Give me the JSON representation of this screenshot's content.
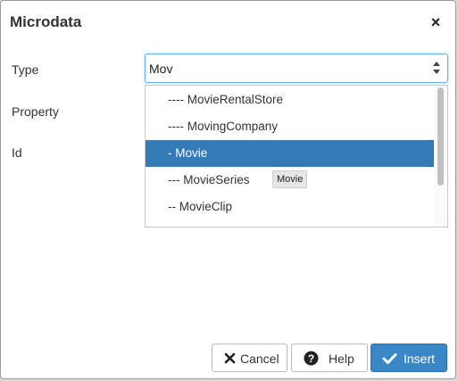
{
  "dialog": {
    "title": "Microdata",
    "close_glyph": "×"
  },
  "fields": {
    "type_label": "Type",
    "property_label": "Property",
    "id_label": "Id"
  },
  "type_select": {
    "value": "Mov"
  },
  "dropdown": {
    "options": [
      {
        "label": "---- MovieRentalStore"
      },
      {
        "label": "---- MovingCompany"
      },
      {
        "label": "- Movie",
        "selected": true
      },
      {
        "label": "--- MovieSeries"
      },
      {
        "label": "-- MovieClip"
      }
    ]
  },
  "tooltip": {
    "text": "Movie"
  },
  "buttons": {
    "cancel": {
      "label": "Cancel",
      "icon": "close-icon"
    },
    "help": {
      "label": "Help",
      "icon": "help-icon"
    },
    "insert": {
      "label": "Insert",
      "icon": "checkmark-icon"
    }
  },
  "colors": {
    "accent": "#337ab7",
    "primary_button": "#3a87c8",
    "focus_border": "#66afe9"
  }
}
